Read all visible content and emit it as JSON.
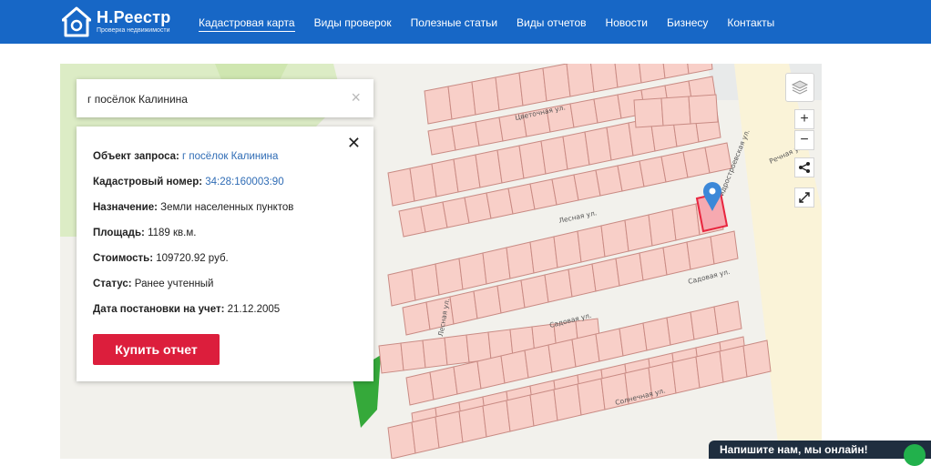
{
  "header": {
    "brand_name": "Н.Реестр",
    "brand_sub": "Проверка недвижимости",
    "nav": [
      {
        "label": "Кадастровая карта",
        "active": true
      },
      {
        "label": "Виды проверок"
      },
      {
        "label": "Полезные статьи"
      },
      {
        "label": "Виды отчетов"
      },
      {
        "label": "Новости"
      },
      {
        "label": "Бизнесу"
      },
      {
        "label": "Контакты"
      }
    ]
  },
  "search": {
    "value": "г посёлок Калинина",
    "clear_icon": "×"
  },
  "info": {
    "close_icon": "✕",
    "object_label": "Объект запроса:",
    "object_value": "г посёлок Калинина",
    "cadastral_label": "Кадастровый номер:",
    "cadastral_value": "34:28:160003:90",
    "purpose_label": "Назначение:",
    "purpose_value": "Земли населенных пунктов",
    "area_label": "Площадь:",
    "area_value": "1189 кв.м.",
    "cost_label": "Стоимость:",
    "cost_value": "109720.92 руб.",
    "status_label": "Статус:",
    "status_value": "Ранее учтенный",
    "date_label": "Дата постановки на учет:",
    "date_value": "21.12.2005",
    "buy_label": "Купить отчет"
  },
  "map": {
    "streets": [
      "Цветочная ул.",
      "Лесная ул.",
      "Гидростроевская ул.",
      "Речная ул.",
      "Садовая ул.",
      "Садовая ул.",
      "Лесная ул.",
      "Солнечная ул."
    ],
    "controls": {
      "zoom_in": "+",
      "zoom_out": "−"
    },
    "colors": {
      "parcel_fill": "#f8cfc8",
      "parcel_stroke": "#c98b84",
      "selected": "#e8263f",
      "marker": "#3c88d8"
    }
  },
  "chat": {
    "label": "Напишите нам, мы онлайн!"
  }
}
